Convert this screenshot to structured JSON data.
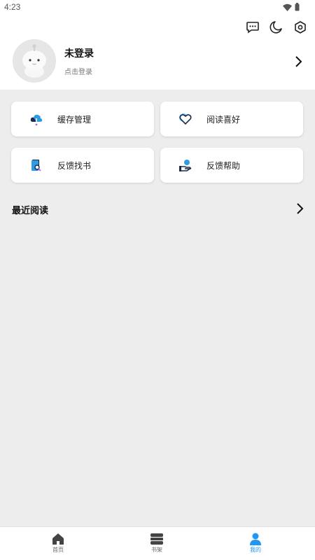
{
  "status_bar": {
    "time": "4:23"
  },
  "top_actions": {
    "icons": [
      "message-icon",
      "night-mode-icon",
      "settings-icon"
    ]
  },
  "profile": {
    "name": "未登录",
    "subtitle": "点击登录"
  },
  "cards": [
    {
      "label": "缓存管理",
      "icon": "cloud-download-icon"
    },
    {
      "label": "阅读喜好",
      "icon": "heart-icon"
    },
    {
      "label": "反馈找书",
      "icon": "book-search-icon"
    },
    {
      "label": "反馈帮助",
      "icon": "help-hand-icon"
    }
  ],
  "recent": {
    "title": "最近阅读"
  },
  "bottom_nav": {
    "items": [
      {
        "label": "首页",
        "icon": "home-icon"
      },
      {
        "label": "书架",
        "icon": "bookshelf-icon"
      },
      {
        "label": "我的",
        "icon": "user-icon"
      }
    ],
    "active": "我的"
  },
  "colors": {
    "accent": "#2196f3",
    "background": "#ededed",
    "card": "#ffffff"
  }
}
